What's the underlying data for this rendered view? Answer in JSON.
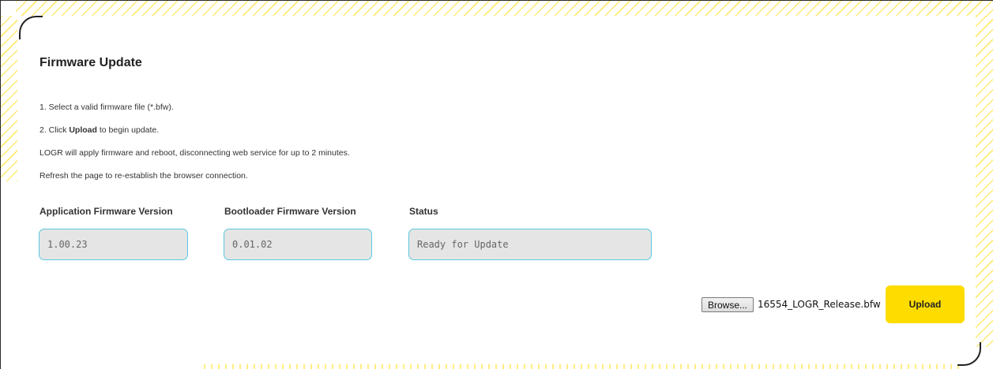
{
  "page": {
    "title": "Firmware Update"
  },
  "instructions": {
    "step1": "1. Select a valid firmware file (*.bfw).",
    "step2_prefix": "2. Click ",
    "step2_bold": "Upload",
    "step2_suffix": " to begin update.",
    "line3": "LOGR will apply firmware and reboot, disconnecting web service for up to 2 minutes.",
    "line4": "Refresh the page to re-establish the browser connection."
  },
  "fields": {
    "app_fw_label": "Application Firmware Version",
    "app_fw_value": "1.00.23",
    "boot_fw_label": "Bootloader Firmware Version",
    "boot_fw_value": "0.01.02",
    "status_label": "Status",
    "status_value": "Ready for Update"
  },
  "file_picker": {
    "browse_label": "Browse...",
    "selected_file": "16554_LOGR_Release.bfw"
  },
  "actions": {
    "upload_label": "Upload"
  },
  "colors": {
    "accent": "#ffdc00",
    "field_border": "#5bc8e0",
    "field_bg": "#e5e5e5"
  }
}
